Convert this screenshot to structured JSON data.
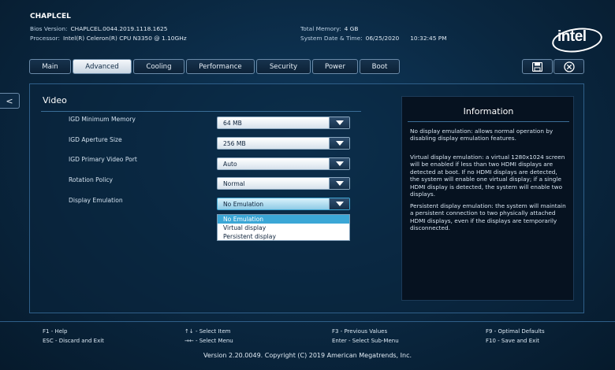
{
  "header": {
    "brand": "CHAPLCEL",
    "bios_version_label": "Bios Version:",
    "bios_version": "CHAPLCEL.0044.2019.1118.1625",
    "processor_label": "Processor:",
    "processor": "Intel(R) Celeron(R) CPU N3350 @ 1.10GHz",
    "total_memory_label": "Total Memory:",
    "total_memory": "4 GB",
    "system_datetime_label": "System Date & Time:",
    "system_date": "06/25/2020",
    "system_time": "10:32:45 PM",
    "logo_text": "intel"
  },
  "tabs": [
    {
      "label": "Main"
    },
    {
      "label": "Advanced"
    },
    {
      "label": "Cooling"
    },
    {
      "label": "Performance"
    },
    {
      "label": "Security"
    },
    {
      "label": "Power"
    },
    {
      "label": "Boot"
    }
  ],
  "active_tab": "Advanced",
  "toolbar": {
    "save_icon": "save-icon",
    "exit_icon": "close-circle-icon",
    "back_label": "<"
  },
  "section": {
    "title": "Video"
  },
  "settings": [
    {
      "label": "IGD Minimum Memory",
      "value": "64 MB"
    },
    {
      "label": "IGD Aperture Size",
      "value": "256 MB"
    },
    {
      "label": "IGD Primary Video Port",
      "value": "Auto"
    },
    {
      "label": "Rotation Policy",
      "value": "Normal"
    },
    {
      "label": "Display Emulation",
      "value": "No Emulation"
    }
  ],
  "dropdown": {
    "options": [
      "No Emulation",
      "Virtual display",
      "Persistent display"
    ],
    "selected": "No Emulation"
  },
  "info": {
    "title": "Information",
    "paragraphs": [
      "No display emulation: allows normal operation by disabling display emulation features.",
      "Virtual display emulation: a virtual 1280x1024 screen will be enabled if less than two HDMI displays are detected at boot. If no HDMI displays are detected, the system will enable one virtual display; if a single HDMI display is detected, the system will enable two displays.",
      "Persistent display emulation: the system will maintain a persistent connection to two physically attached HDMI displays, even if the displays are temporarily disconnected."
    ]
  },
  "footer": {
    "help": "F1 - Help",
    "discard": "ESC - Discard and Exit",
    "select_item": "↑↓ - Select Item",
    "select_menu": "→← - Select Menu",
    "previous": "F3 - Previous Values",
    "submenu": "Enter - Select Sub-Menu",
    "defaults": "F9 - Optimal Defaults",
    "save_exit": "F10 - Save and Exit",
    "copyright": "Version 2.20.0049. Copyright (C) 2019 American Megatrends, Inc."
  },
  "colors": {
    "background": "#0a2740",
    "accent": "#3ba7d6",
    "info_bg": "#061220"
  }
}
